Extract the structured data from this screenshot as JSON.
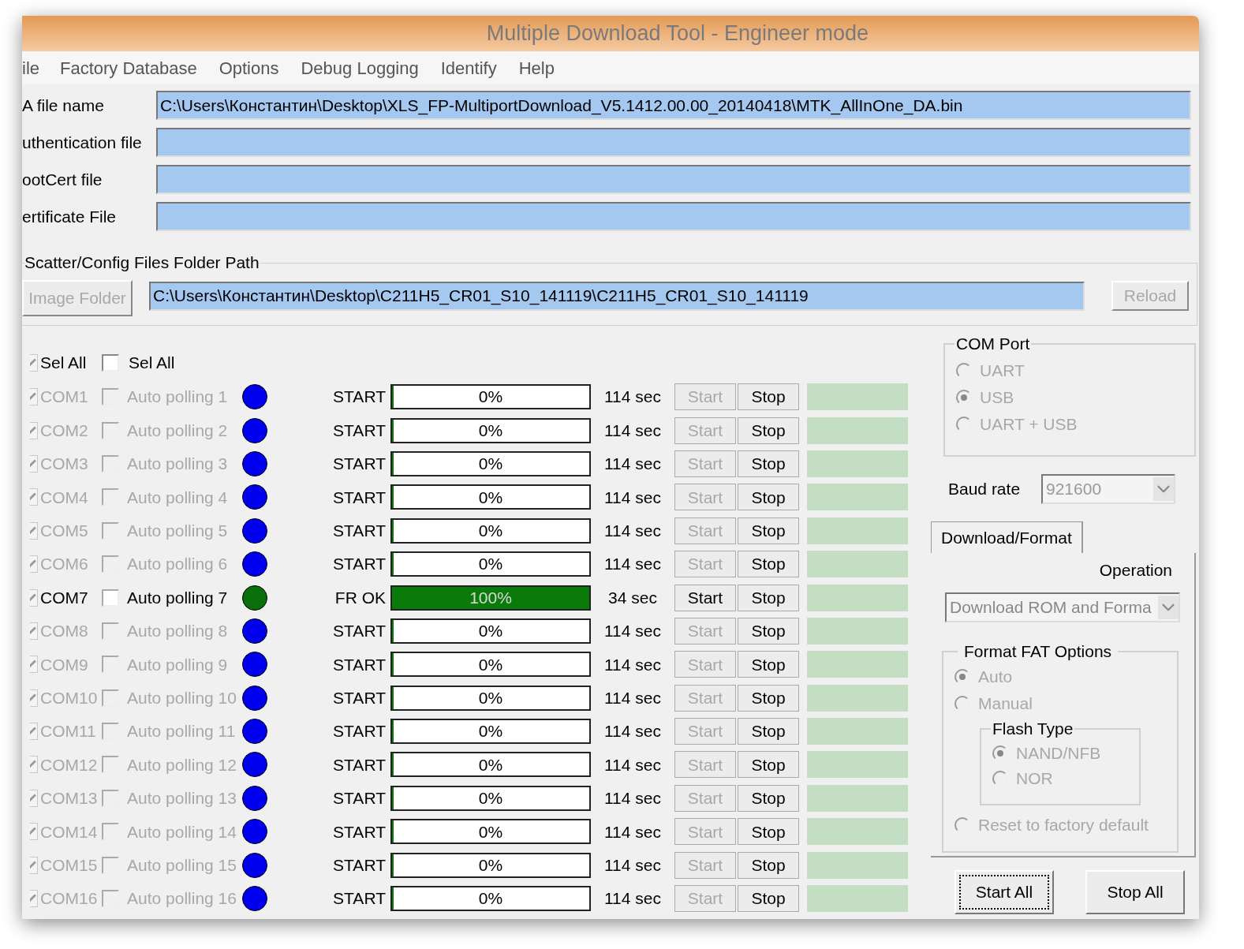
{
  "window": {
    "title": "Multiple Download Tool - Engineer mode"
  },
  "menu": [
    "ile",
    "Factory Database",
    "Options",
    "Debug Logging",
    "Identify",
    "Help"
  ],
  "file_fields": [
    {
      "label": "A file name",
      "value": "C:\\Users\\Константин\\Desktop\\XLS_FP-MultiportDownload_V5.1412.00.00_20140418\\MTK_AllInOne_DA.bin"
    },
    {
      "label": "uthentication file"
    },
    {
      "label": "ootCert file"
    },
    {
      "label": "ertificate File"
    }
  ],
  "scatter": {
    "legend": "Scatter/Config Files Folder Path",
    "image_folder_button": {
      "label": "Image Folder",
      "disabled": true
    },
    "path": "C:\\Users\\Константин\\Desktop\\C211H5_CR01_S10_141119\\C211H5_CR01_S10_141119",
    "reload_button": {
      "label": "Reload",
      "disabled": true
    }
  },
  "select_all": [
    {
      "label": "Sel All",
      "checked": true
    },
    {
      "label": "Sel All",
      "checked": false
    }
  ],
  "ports": [
    {
      "name": "COM1",
      "port_checked": true,
      "disabled": true,
      "auto_polling": "Auto polling 1",
      "auto_checked": false,
      "color": "#0000ee",
      "status": "START",
      "level": 0,
      "progress": "0%",
      "time": "114 sec",
      "start": "Start",
      "stop": "Stop"
    },
    {
      "name": "COM2",
      "port_checked": true,
      "disabled": true,
      "auto_polling": "Auto polling 2",
      "auto_checked": false,
      "color": "#0000ee",
      "status": "START",
      "level": 0,
      "progress": "0%",
      "time": "114 sec",
      "start": "Start",
      "stop": "Stop"
    },
    {
      "name": "COM3",
      "port_checked": true,
      "disabled": true,
      "auto_polling": "Auto polling 3",
      "auto_checked": false,
      "color": "#0000ee",
      "status": "START",
      "level": 0,
      "progress": "0%",
      "time": "114 sec",
      "start": "Start",
      "stop": "Stop"
    },
    {
      "name": "COM4",
      "port_checked": true,
      "disabled": true,
      "auto_polling": "Auto polling 4",
      "auto_checked": false,
      "color": "#0000ee",
      "status": "START",
      "level": 0,
      "progress": "0%",
      "time": "114 sec",
      "start": "Start",
      "stop": "Stop"
    },
    {
      "name": "COM5",
      "port_checked": true,
      "disabled": true,
      "auto_polling": "Auto polling 5",
      "auto_checked": false,
      "color": "#0000ee",
      "status": "START",
      "level": 0,
      "progress": "0%",
      "time": "114 sec",
      "start": "Start",
      "stop": "Stop"
    },
    {
      "name": "COM6",
      "port_checked": true,
      "disabled": true,
      "auto_polling": "Auto polling 6",
      "auto_checked": false,
      "color": "#0000ee",
      "status": "START",
      "level": 0,
      "progress": "0%",
      "time": "114 sec",
      "start": "Start",
      "stop": "Stop"
    },
    {
      "name": "COM7",
      "port_checked": true,
      "disabled": false,
      "auto_polling": "Auto polling 7",
      "auto_checked": false,
      "color": "#0a6e0a",
      "status": "FR OK",
      "level": 1,
      "progress": "100%",
      "time": "34 sec",
      "start": "Start",
      "stop": "Stop"
    },
    {
      "name": "COM8",
      "port_checked": true,
      "disabled": true,
      "auto_polling": "Auto polling 8",
      "auto_checked": false,
      "color": "#0000ee",
      "status": "START",
      "level": 0,
      "progress": "0%",
      "time": "114 sec",
      "start": "Start",
      "stop": "Stop"
    },
    {
      "name": "COM9",
      "port_checked": true,
      "disabled": true,
      "auto_polling": "Auto polling 9",
      "auto_checked": false,
      "color": "#0000ee",
      "status": "START",
      "level": 0,
      "progress": "0%",
      "time": "114 sec",
      "start": "Start",
      "stop": "Stop"
    },
    {
      "name": "COM10",
      "port_checked": true,
      "disabled": true,
      "auto_polling": "Auto polling 10",
      "auto_checked": false,
      "color": "#0000ee",
      "status": "START",
      "level": 0,
      "progress": "0%",
      "time": "114 sec",
      "start": "Start",
      "stop": "Stop"
    },
    {
      "name": "COM11",
      "port_checked": true,
      "disabled": true,
      "auto_polling": "Auto polling 11",
      "auto_checked": false,
      "color": "#0000ee",
      "status": "START",
      "level": 0,
      "progress": "0%",
      "time": "114 sec",
      "start": "Start",
      "stop": "Stop"
    },
    {
      "name": "COM12",
      "port_checked": true,
      "disabled": true,
      "auto_polling": "Auto polling 12",
      "auto_checked": false,
      "color": "#0000ee",
      "status": "START",
      "level": 0,
      "progress": "0%",
      "time": "114 sec",
      "start": "Start",
      "stop": "Stop"
    },
    {
      "name": "COM13",
      "port_checked": true,
      "disabled": true,
      "auto_polling": "Auto polling 13",
      "auto_checked": false,
      "color": "#0000ee",
      "status": "START",
      "level": 0,
      "progress": "0%",
      "time": "114 sec",
      "start": "Start",
      "stop": "Stop"
    },
    {
      "name": "COM14",
      "port_checked": true,
      "disabled": true,
      "auto_polling": "Auto polling 14",
      "auto_checked": false,
      "color": "#0000ee",
      "status": "START",
      "level": 0,
      "progress": "0%",
      "time": "114 sec",
      "start": "Start",
      "stop": "Stop"
    },
    {
      "name": "COM15",
      "port_checked": true,
      "disabled": true,
      "auto_polling": "Auto polling 15",
      "auto_checked": false,
      "color": "#0000ee",
      "status": "START",
      "level": 0,
      "progress": "0%",
      "time": "114 sec",
      "start": "Start",
      "stop": "Stop"
    },
    {
      "name": "COM16",
      "port_checked": true,
      "disabled": true,
      "auto_polling": "Auto polling 16",
      "auto_checked": false,
      "color": "#0000ee",
      "status": "START",
      "level": 0,
      "progress": "0%",
      "time": "114 sec",
      "start": "Start",
      "stop": "Stop"
    }
  ],
  "com_port": {
    "legend": "COM Port",
    "disabled": true,
    "options": [
      {
        "label": "UART",
        "selected": false
      },
      {
        "label": "USB",
        "selected": true
      },
      {
        "label": "UART + USB",
        "selected": false
      }
    ]
  },
  "baud_rate": {
    "label": "Baud rate",
    "value": "921600"
  },
  "tab": {
    "label": "Download/Format",
    "selected": true
  },
  "operation": {
    "label": "Operation",
    "value": "Download ROM and Forma"
  },
  "format_fat": {
    "legend": "Format FAT Options",
    "disabled": true,
    "options": [
      {
        "label": "Auto",
        "selected": true
      },
      {
        "label": "Manual",
        "selected": false
      }
    ],
    "flash_type": {
      "legend": "Flash  Type",
      "options": [
        {
          "label": "NAND/NFB",
          "selected": true
        },
        {
          "label": "NOR",
          "selected": false
        }
      ]
    },
    "reset": {
      "label": "Reset to factory default",
      "selected": false
    }
  },
  "buttons": [
    {
      "label": "Start All",
      "focused": true
    },
    {
      "label": "Stop All",
      "focused": false
    }
  ]
}
